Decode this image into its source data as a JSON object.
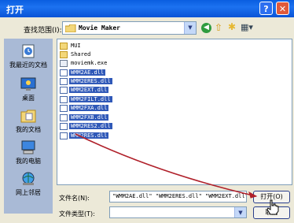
{
  "dialog": {
    "title": "打开",
    "help_glyph": "?",
    "close_glyph": "✕"
  },
  "toolbar": {
    "look_in_label": "查找范围(I):",
    "look_in_value": "Movie Maker",
    "icons": [
      "back-icon",
      "up-folder-icon",
      "new-folder-icon",
      "views-menu-icon"
    ]
  },
  "places": [
    {
      "label": "我最近的文档",
      "icon": "recent-documents-icon"
    },
    {
      "label": "桌面",
      "icon": "desktop-icon"
    },
    {
      "label": "我的文档",
      "icon": "my-documents-icon"
    },
    {
      "label": "我的电脑",
      "icon": "my-computer-icon"
    },
    {
      "label": "网上邻居",
      "icon": "network-places-icon"
    }
  ],
  "files": [
    {
      "name": "MUI",
      "type": "folder",
      "selected": false
    },
    {
      "name": "Shared",
      "type": "folder",
      "selected": false
    },
    {
      "name": "moviemk.exe",
      "type": "exe",
      "selected": false
    },
    {
      "name": "WMM2AE.dll",
      "type": "dll",
      "selected": true
    },
    {
      "name": "WMM2ERES.dll",
      "type": "dll",
      "selected": true
    },
    {
      "name": "WMM2EXT.dll",
      "type": "dll",
      "selected": true
    },
    {
      "name": "WMM2FILT.dll",
      "type": "dll",
      "selected": true
    },
    {
      "name": "WMM2FXA.dll",
      "type": "dll",
      "selected": true
    },
    {
      "name": "WMM2FXB.dll",
      "type": "dll",
      "selected": true
    },
    {
      "name": "WMM2RES2.dll",
      "type": "dll",
      "selected": true
    },
    {
      "name": "WMM2RES.dll",
      "type": "dll",
      "selected": true
    }
  ],
  "filename": {
    "label": "文件名(N):",
    "value": "\"WMM2AE.dll\" \"WMM2ERES.dll\" \"WMM2EXT.dll\""
  },
  "filetype": {
    "label": "文件类型(T):",
    "value": ""
  },
  "buttons": {
    "open_label": "打开(O)",
    "cancel_label": "取消"
  },
  "colors": {
    "title_bar": "#0a5ee0",
    "selection": "#3059b8",
    "annotation_arrow": "#b0202a"
  }
}
